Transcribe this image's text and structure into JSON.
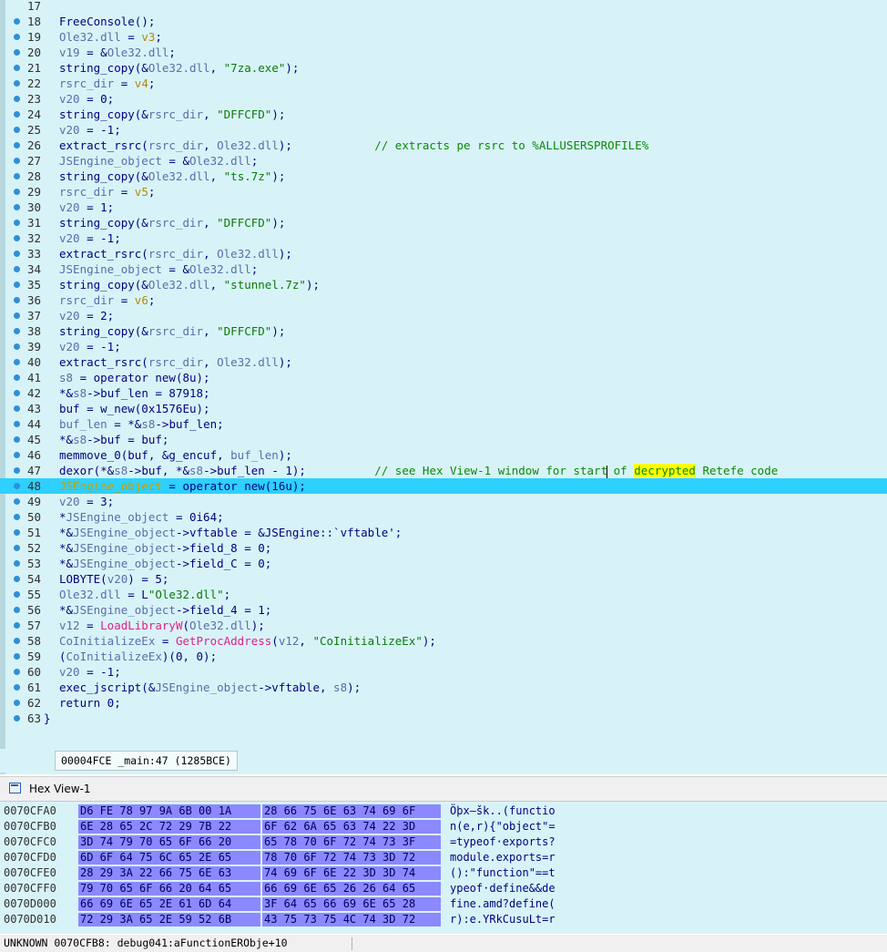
{
  "code_lines": [
    {
      "n": "17",
      "dot": false,
      "parts": []
    },
    {
      "n": "18",
      "dot": true,
      "parts": [
        [
          "fn",
          "FreeConsole"
        ],
        [
          "t",
          "();"
        ]
      ]
    },
    {
      "n": "19",
      "dot": true,
      "parts": [
        [
          "var",
          "Ole32.dll"
        ],
        [
          "t",
          " = "
        ],
        [
          "loc",
          "v3"
        ],
        [
          "t",
          ";"
        ]
      ]
    },
    {
      "n": "20",
      "dot": true,
      "parts": [
        [
          "var",
          "v19"
        ],
        [
          "t",
          " = &"
        ],
        [
          "var",
          "Ole32.dll"
        ],
        [
          "t",
          ";"
        ]
      ]
    },
    {
      "n": "21",
      "dot": true,
      "parts": [
        [
          "t",
          "string_copy(&"
        ],
        [
          "var",
          "Ole32.dll"
        ],
        [
          "t",
          ", "
        ],
        [
          "str",
          "\"7za.exe\""
        ],
        [
          "t",
          ");"
        ]
      ]
    },
    {
      "n": "22",
      "dot": true,
      "parts": [
        [
          "var",
          "rsrc_dir"
        ],
        [
          "t",
          " = "
        ],
        [
          "loc",
          "v4"
        ],
        [
          "t",
          ";"
        ]
      ]
    },
    {
      "n": "23",
      "dot": true,
      "parts": [
        [
          "var",
          "v20"
        ],
        [
          "t",
          " = 0;"
        ]
      ]
    },
    {
      "n": "24",
      "dot": true,
      "parts": [
        [
          "t",
          "string_copy(&"
        ],
        [
          "var",
          "rsrc_dir"
        ],
        [
          "t",
          ", "
        ],
        [
          "str",
          "\"DFFCFD\""
        ],
        [
          "t",
          ");"
        ]
      ]
    },
    {
      "n": "25",
      "dot": true,
      "parts": [
        [
          "var",
          "v20"
        ],
        [
          "t",
          " = -1;"
        ]
      ]
    },
    {
      "n": "26",
      "dot": true,
      "parts": [
        [
          "t",
          "extract_rsrc("
        ],
        [
          "var",
          "rsrc_dir"
        ],
        [
          "t",
          ", "
        ],
        [
          "var",
          "Ole32.dll"
        ],
        [
          "t",
          ");            "
        ],
        [
          "cmt",
          "// extracts pe rsrc to %ALLUSERSPROFILE%"
        ]
      ]
    },
    {
      "n": "27",
      "dot": true,
      "parts": [
        [
          "var",
          "JSEngine_object"
        ],
        [
          "t",
          " = &"
        ],
        [
          "var",
          "Ole32.dll"
        ],
        [
          "t",
          ";"
        ]
      ]
    },
    {
      "n": "28",
      "dot": true,
      "parts": [
        [
          "t",
          "string_copy(&"
        ],
        [
          "var",
          "Ole32.dll"
        ],
        [
          "t",
          ", "
        ],
        [
          "str",
          "\"ts.7z\""
        ],
        [
          "t",
          ");"
        ]
      ]
    },
    {
      "n": "29",
      "dot": true,
      "parts": [
        [
          "var",
          "rsrc_dir"
        ],
        [
          "t",
          " = "
        ],
        [
          "loc",
          "v5"
        ],
        [
          "t",
          ";"
        ]
      ]
    },
    {
      "n": "30",
      "dot": true,
      "parts": [
        [
          "var",
          "v20"
        ],
        [
          "t",
          " = 1;"
        ]
      ]
    },
    {
      "n": "31",
      "dot": true,
      "parts": [
        [
          "t",
          "string_copy(&"
        ],
        [
          "var",
          "rsrc_dir"
        ],
        [
          "t",
          ", "
        ],
        [
          "str",
          "\"DFFCFD\""
        ],
        [
          "t",
          ");"
        ]
      ]
    },
    {
      "n": "32",
      "dot": true,
      "parts": [
        [
          "var",
          "v20"
        ],
        [
          "t",
          " = -1;"
        ]
      ]
    },
    {
      "n": "33",
      "dot": true,
      "parts": [
        [
          "t",
          "extract_rsrc("
        ],
        [
          "var",
          "rsrc_dir"
        ],
        [
          "t",
          ", "
        ],
        [
          "var",
          "Ole32.dll"
        ],
        [
          "t",
          ");"
        ]
      ]
    },
    {
      "n": "34",
      "dot": true,
      "parts": [
        [
          "var",
          "JSEngine_object"
        ],
        [
          "t",
          " = &"
        ],
        [
          "var",
          "Ole32.dll"
        ],
        [
          "t",
          ";"
        ]
      ]
    },
    {
      "n": "35",
      "dot": true,
      "parts": [
        [
          "t",
          "string_copy(&"
        ],
        [
          "var",
          "Ole32.dll"
        ],
        [
          "t",
          ", "
        ],
        [
          "str",
          "\"stunnel.7z\""
        ],
        [
          "t",
          ");"
        ]
      ]
    },
    {
      "n": "36",
      "dot": true,
      "parts": [
        [
          "var",
          "rsrc_dir"
        ],
        [
          "t",
          " = "
        ],
        [
          "loc",
          "v6"
        ],
        [
          "t",
          ";"
        ]
      ]
    },
    {
      "n": "37",
      "dot": true,
      "parts": [
        [
          "var",
          "v20"
        ],
        [
          "t",
          " = 2;"
        ]
      ]
    },
    {
      "n": "38",
      "dot": true,
      "parts": [
        [
          "t",
          "string_copy(&"
        ],
        [
          "var",
          "rsrc_dir"
        ],
        [
          "t",
          ", "
        ],
        [
          "str",
          "\"DFFCFD\""
        ],
        [
          "t",
          ");"
        ]
      ]
    },
    {
      "n": "39",
      "dot": true,
      "parts": [
        [
          "var",
          "v20"
        ],
        [
          "t",
          " = -1;"
        ]
      ]
    },
    {
      "n": "40",
      "dot": true,
      "parts": [
        [
          "t",
          "extract_rsrc("
        ],
        [
          "var",
          "rsrc_dir"
        ],
        [
          "t",
          ", "
        ],
        [
          "var",
          "Ole32.dll"
        ],
        [
          "t",
          ");"
        ]
      ]
    },
    {
      "n": "41",
      "dot": true,
      "parts": [
        [
          "var",
          "s8"
        ],
        [
          "t",
          " = operator new(8u);"
        ]
      ]
    },
    {
      "n": "42",
      "dot": true,
      "parts": [
        [
          "t",
          "*&"
        ],
        [
          "var",
          "s8"
        ],
        [
          "t",
          "->buf_len = 87918;"
        ]
      ]
    },
    {
      "n": "43",
      "dot": true,
      "parts": [
        [
          "t",
          "buf = w_new(0x1576Eu);"
        ]
      ]
    },
    {
      "n": "44",
      "dot": true,
      "parts": [
        [
          "var",
          "buf_len"
        ],
        [
          "t",
          " = *&"
        ],
        [
          "var",
          "s8"
        ],
        [
          "t",
          "->buf_len;"
        ]
      ]
    },
    {
      "n": "45",
      "dot": true,
      "parts": [
        [
          "t",
          "*&"
        ],
        [
          "var",
          "s8"
        ],
        [
          "t",
          "->buf = buf;"
        ]
      ]
    },
    {
      "n": "46",
      "dot": true,
      "parts": [
        [
          "t",
          "memmove_0(buf, &g_encuf, "
        ],
        [
          "var",
          "buf_len"
        ],
        [
          "t",
          ");"
        ]
      ]
    },
    {
      "n": "47",
      "dot": true,
      "parts": [
        [
          "t",
          "dexor(*&"
        ],
        [
          "var",
          "s8"
        ],
        [
          "t",
          "->buf, *&"
        ],
        [
          "var",
          "s8"
        ],
        [
          "t",
          "->buf_len - 1);          "
        ],
        [
          "cmt",
          "// see Hex View-1 window for start"
        ],
        [
          "caret",
          ""
        ],
        [
          "cmt",
          " of "
        ],
        [
          "mark",
          "decrypted"
        ],
        [
          "cmt",
          " Retefe code"
        ]
      ]
    },
    {
      "n": "48",
      "dot": true,
      "hl": true,
      "parts": [
        [
          "gold",
          "JSEngine_object"
        ],
        [
          "t",
          " = operator new(16u);"
        ]
      ]
    },
    {
      "n": "49",
      "dot": true,
      "parts": [
        [
          "var",
          "v20"
        ],
        [
          "t",
          " = 3;"
        ]
      ]
    },
    {
      "n": "50",
      "dot": true,
      "parts": [
        [
          "t",
          "*"
        ],
        [
          "var",
          "JSEngine_object"
        ],
        [
          "t",
          " = 0i64;"
        ]
      ]
    },
    {
      "n": "51",
      "dot": true,
      "parts": [
        [
          "t",
          "*&"
        ],
        [
          "var",
          "JSEngine_object"
        ],
        [
          "t",
          "->vftable = &JSEngine::`vftable';"
        ]
      ]
    },
    {
      "n": "52",
      "dot": true,
      "parts": [
        [
          "t",
          "*&"
        ],
        [
          "var",
          "JSEngine_object"
        ],
        [
          "t",
          "->field_8 = 0;"
        ]
      ]
    },
    {
      "n": "53",
      "dot": true,
      "parts": [
        [
          "t",
          "*&"
        ],
        [
          "var",
          "JSEngine_object"
        ],
        [
          "t",
          "->field_C = 0;"
        ]
      ]
    },
    {
      "n": "54",
      "dot": true,
      "parts": [
        [
          "t",
          "LOBYTE("
        ],
        [
          "var",
          "v20"
        ],
        [
          "t",
          ") = 5;"
        ]
      ]
    },
    {
      "n": "55",
      "dot": true,
      "parts": [
        [
          "var",
          "Ole32.dll"
        ],
        [
          "t",
          " = L"
        ],
        [
          "str",
          "\"Ole32.dll\""
        ],
        [
          "t",
          ";"
        ]
      ]
    },
    {
      "n": "56",
      "dot": true,
      "parts": [
        [
          "t",
          "*&"
        ],
        [
          "var",
          "JSEngine_object"
        ],
        [
          "t",
          "->field_4 = 1;"
        ]
      ]
    },
    {
      "n": "57",
      "dot": true,
      "parts": [
        [
          "var",
          "v12"
        ],
        [
          "t",
          " = "
        ],
        [
          "api",
          "LoadLibraryW"
        ],
        [
          "t",
          "("
        ],
        [
          "var",
          "Ole32.dll"
        ],
        [
          "t",
          ");"
        ]
      ]
    },
    {
      "n": "58",
      "dot": true,
      "parts": [
        [
          "var",
          "CoInitializeEx"
        ],
        [
          "t",
          " = "
        ],
        [
          "api",
          "GetProcAddress"
        ],
        [
          "t",
          "("
        ],
        [
          "var",
          "v12"
        ],
        [
          "t",
          ", "
        ],
        [
          "str",
          "\"CoInitializeEx\""
        ],
        [
          "t",
          ");"
        ]
      ]
    },
    {
      "n": "59",
      "dot": true,
      "parts": [
        [
          "t",
          "("
        ],
        [
          "var",
          "CoInitializeEx"
        ],
        [
          "t",
          ")(0, 0);"
        ]
      ]
    },
    {
      "n": "60",
      "dot": true,
      "parts": [
        [
          "var",
          "v20"
        ],
        [
          "t",
          " = -1;"
        ]
      ]
    },
    {
      "n": "61",
      "dot": true,
      "parts": [
        [
          "t",
          "exec_jscript(&"
        ],
        [
          "var",
          "JSEngine_object"
        ],
        [
          "t",
          "->vftable, "
        ],
        [
          "var",
          "s8"
        ],
        [
          "t",
          ");"
        ]
      ]
    },
    {
      "n": "62",
      "dot": true,
      "parts": [
        [
          "t",
          "return 0;"
        ]
      ]
    },
    {
      "n": "63",
      "dot": true,
      "brace": true,
      "parts": [
        [
          "t",
          "}"
        ]
      ]
    }
  ],
  "pseudocode_status": "00004FCE _main:47 (1285BCE)",
  "hex_view": {
    "title": "Hex View-1",
    "rows": [
      {
        "addr": "0070CFA0",
        "b1": "D6 FE 78 97 9A 6B 00 1A",
        "b2": "28 66 75 6E 63 74 69 6F",
        "ascii": "Öþx—šk..(functio"
      },
      {
        "addr": "0070CFB0",
        "b1": "6E 28 65 2C 72 29 7B 22",
        "b2": "6F 62 6A 65 63 74 22 3D",
        "ascii": "n(e,r){\"object\"="
      },
      {
        "addr": "0070CFC0",
        "b1": "3D 74 79 70 65 6F 66 20",
        "b2": "65 78 70 6F 72 74 73 3F",
        "ascii": "=typeof·exports?"
      },
      {
        "addr": "0070CFD0",
        "b1": "6D 6F 64 75 6C 65 2E 65",
        "b2": "78 70 6F 72 74 73 3D 72",
        "ascii": "module.exports=r"
      },
      {
        "addr": "0070CFE0",
        "b1": "28 29 3A 22 66 75 6E 63",
        "b2": "74 69 6F 6E 22 3D 3D 74",
        "ascii": "():\"function\"==t"
      },
      {
        "addr": "0070CFF0",
        "b1": "79 70 65 6F 66 20 64 65",
        "b2": "66 69 6E 65 26 26 64 65",
        "ascii": "ypeof·define&&de"
      },
      {
        "addr": "0070D000",
        "b1": "66 69 6E 65 2E 61 6D 64",
        "b2": "3F 64 65 66 69 6E 65 28",
        "ascii": "fine.amd?define("
      },
      {
        "addr": "0070D010",
        "b1": "72 29 3A 65 2E 59 52 6B",
        "b2": "43 75 73 75 4C 74 3D 72",
        "ascii": "r):e.YRkCusuLt=r"
      }
    ]
  },
  "bottom_status": "UNKNOWN 0070CFB8: debug041:aFunctionERObje+10"
}
